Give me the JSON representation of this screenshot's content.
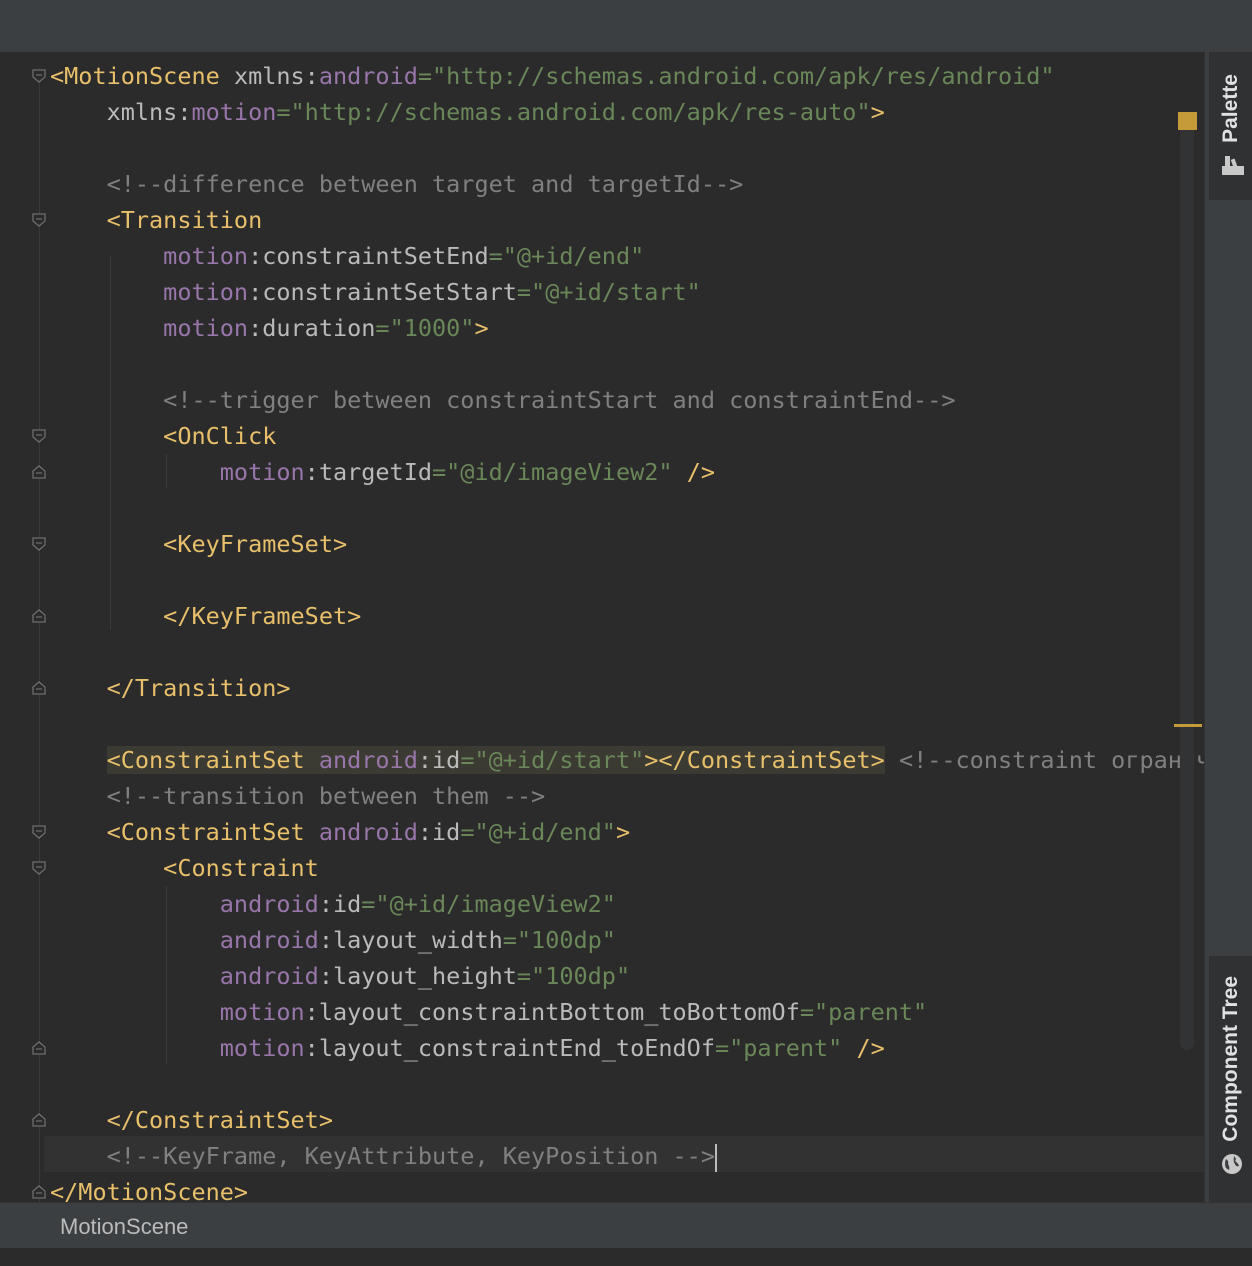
{
  "editor": {
    "lines": [
      [
        {
          "c": "tag",
          "t": "<MotionScene "
        },
        {
          "c": "attr",
          "t": "xmlns:"
        },
        {
          "c": "ns",
          "t": "android"
        },
        {
          "c": "str",
          "t": "=\"http://schemas.android.com/apk/res/android\""
        }
      ],
      [
        {
          "c": "attr",
          "t": "    xmlns:"
        },
        {
          "c": "ns",
          "t": "motion"
        },
        {
          "c": "str",
          "t": "=\"http://schemas.android.com/apk/res-auto\""
        },
        {
          "c": "tag",
          "t": ">"
        }
      ],
      [],
      [
        {
          "c": "cmt",
          "t": "    <!--difference between target and targetId-->"
        }
      ],
      [
        {
          "c": "tag",
          "t": "    <Transition"
        }
      ],
      [
        {
          "c": "ns",
          "t": "        motion"
        },
        {
          "c": "attr",
          "t": ":constraintSetEnd"
        },
        {
          "c": "str",
          "t": "=\"@+id/end\""
        }
      ],
      [
        {
          "c": "ns",
          "t": "        motion"
        },
        {
          "c": "attr",
          "t": ":constraintSetStart"
        },
        {
          "c": "str",
          "t": "=\"@+id/start\""
        }
      ],
      [
        {
          "c": "ns",
          "t": "        motion"
        },
        {
          "c": "attr",
          "t": ":duration"
        },
        {
          "c": "str",
          "t": "=\"1000\""
        },
        {
          "c": "tag",
          "t": ">"
        }
      ],
      [],
      [
        {
          "c": "cmt",
          "t": "        <!--trigger between constraintStart and constraintEnd-->"
        }
      ],
      [
        {
          "c": "tag",
          "t": "        <OnClick"
        }
      ],
      [
        {
          "c": "ns",
          "t": "            motion"
        },
        {
          "c": "attr",
          "t": ":targetId"
        },
        {
          "c": "str",
          "t": "=\"@id/imageView2\""
        },
        {
          "c": "tag",
          "t": " />"
        }
      ],
      [],
      [
        {
          "c": "tag",
          "t": "        <KeyFrameSet>"
        }
      ],
      [],
      [
        {
          "c": "tag",
          "t": "        </KeyFrameSet>"
        }
      ],
      [],
      [
        {
          "c": "tag",
          "t": "    </Transition>"
        }
      ],
      [],
      [
        {
          "c": "attr",
          "t": "    "
        },
        {
          "c": "tag hl",
          "t": "<ConstraintSet "
        },
        {
          "c": "ns hl",
          "t": "android"
        },
        {
          "c": "attr hl",
          "t": ":id"
        },
        {
          "c": "str hl",
          "t": "=\"@+id/start\""
        },
        {
          "c": "tag hl",
          "t": "></ConstraintSet>"
        },
        {
          "c": "cmt",
          "t": " <!--constraint ограниче"
        }
      ],
      [
        {
          "c": "cmt",
          "t": "    <!--transition between them -->"
        }
      ],
      [
        {
          "c": "tag",
          "t": "    <ConstraintSet "
        },
        {
          "c": "ns",
          "t": "android"
        },
        {
          "c": "attr",
          "t": ":id"
        },
        {
          "c": "str",
          "t": "=\"@+id/end\""
        },
        {
          "c": "tag",
          "t": ">"
        }
      ],
      [
        {
          "c": "tag",
          "t": "        <Constraint"
        }
      ],
      [
        {
          "c": "ns",
          "t": "            android"
        },
        {
          "c": "attr",
          "t": ":id"
        },
        {
          "c": "str",
          "t": "=\"@+id/imageView2\""
        }
      ],
      [
        {
          "c": "ns",
          "t": "            android"
        },
        {
          "c": "attr",
          "t": ":layout_width"
        },
        {
          "c": "str",
          "t": "=\"100dp\""
        }
      ],
      [
        {
          "c": "ns",
          "t": "            android"
        },
        {
          "c": "attr",
          "t": ":layout_height"
        },
        {
          "c": "str",
          "t": "=\"100dp\""
        }
      ],
      [
        {
          "c": "ns",
          "t": "            motion"
        },
        {
          "c": "attr",
          "t": ":layout_constraintBottom_toBottomOf"
        },
        {
          "c": "str",
          "t": "=\"parent\""
        }
      ],
      [
        {
          "c": "ns",
          "t": "            motion"
        },
        {
          "c": "attr",
          "t": ":layout_constraintEnd_toEndOf"
        },
        {
          "c": "str",
          "t": "=\"parent\""
        },
        {
          "c": "tag",
          "t": " />"
        }
      ],
      [],
      [
        {
          "c": "tag",
          "t": "    </ConstraintSet>"
        }
      ],
      [
        {
          "c": "cmt",
          "t": "    <!--KeyFrame, KeyAttribute, KeyPosition -->"
        },
        {
          "c": "caret",
          "t": ""
        }
      ],
      [
        {
          "c": "tag",
          "t": "</MotionScene>"
        }
      ]
    ],
    "colors": {
      "tag": "#e8bf6a",
      "attr": "#bababa",
      "namespace": "#9876aa",
      "string": "#6a8759",
      "comment": "#808080",
      "background": "#2b2b2b"
    }
  },
  "right_panel": {
    "palette_label": "Palette",
    "component_tree_label": "Component Tree",
    "palette_icon": "palette-icon",
    "component_tree_icon": "globe-icon"
  },
  "status": {
    "breadcrumb": "MotionScene"
  }
}
